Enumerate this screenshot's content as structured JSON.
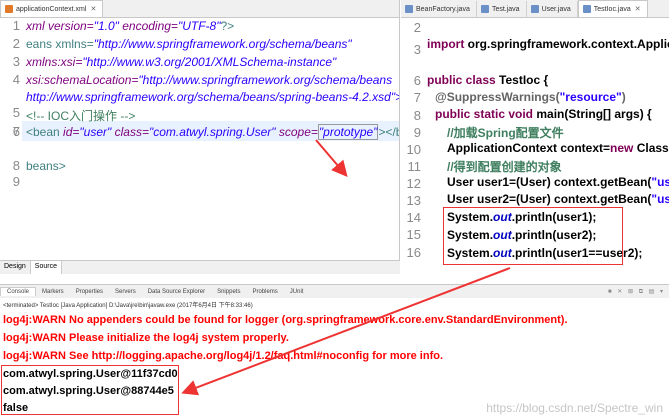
{
  "left_editor": {
    "tab_label": "applicationContext.xml",
    "lines": [
      {
        "num": "1"
      },
      {
        "num": "2"
      },
      {
        "num": "3"
      },
      {
        "num": "4"
      },
      {
        "num": "5"
      },
      {
        "num": "6"
      },
      {
        "num": "7"
      },
      {
        "num": "8"
      },
      {
        "num": "9"
      }
    ],
    "line1": {
      "a": "xml version=",
      "b": "\"1.0\"",
      "c": " encoding=",
      "d": "\"UTF-8\"",
      "e": "?>"
    },
    "line2": {
      "a": "eans xmlns=",
      "b": "\"http://www.springframework.org/schema/beans\""
    },
    "line3": {
      "a": "xmlns:xsi=",
      "b": "\"http://www.w3.org/2001/XMLSchema-instance\""
    },
    "line4": {
      "a": "xsi:schemaLocation=",
      "b": "\"http://www.springframework.org/schema/beans"
    },
    "line4b": "http://www.springframework.org/schema/beans/spring-beans-4.2.xsd\">",
    "line5": "<!-- IOC入门操作 -->",
    "line7": {
      "a": "<bean",
      "b": " id=",
      "c": "\"user\"",
      "d": " class=",
      "e": "\"com.atwyl.spring.User\"",
      "f": " scope=",
      "g": "\"prototype\"",
      "h": "></bean>"
    },
    "line9": "beans>",
    "bottom_tabs": [
      "Design",
      "Source"
    ]
  },
  "right_editor": {
    "tabs": [
      "BeanFactory.java",
      "Test.java",
      "User.java",
      "TestIoc.java"
    ],
    "active_tab": "TestIoc.java",
    "line_numbers": [
      "2",
      "3",
      "6",
      "7",
      "8",
      "9",
      "10",
      "11",
      "12",
      "13",
      "14",
      "15",
      "16"
    ],
    "import_line": {
      "kw": "import",
      "rest": " org.springframework.context.ApplicationCo"
    },
    "class_line": {
      "kw1": "public",
      "kw2": " class",
      "rest": " TestIoc {"
    },
    "suppress_line": {
      "ann": "@SuppressWarnings(",
      "str": "\"resource\"",
      "end": ")"
    },
    "main_line": {
      "kw": "public static void",
      "rest": " main(String[] args) {"
    },
    "comment1": "//加载Spring配置文件",
    "ctx_line": {
      "a": "ApplicationContext context=",
      "kw": "new",
      "b": " ClassPathXm"
    },
    "comment2": "//得到配置创建的对象",
    "user1_line": {
      "a": "User user1=(User) context.getBean(",
      "str": "\"user\"",
      "b": ");"
    },
    "user2_line": {
      "a": "User user2=(User) context.getBean(",
      "str": "\"user\"",
      "b": ");"
    },
    "print1": {
      "a": "System.",
      "fld": "out",
      "b": ".println(user1);"
    },
    "print2": {
      "a": "System.",
      "fld": "out",
      "b": ".println(user2);"
    },
    "print3": {
      "a": "System.",
      "fld": "out",
      "b": ".println(user1==user2);"
    }
  },
  "console": {
    "tabs": [
      "Console",
      "Markers",
      "Properties",
      "Servers",
      "Data Source Explorer",
      "Snippets",
      "Problems",
      "JUnit"
    ],
    "status": "<terminated> TestIoc [Java Application] D:\\Java\\jre\\bin\\javaw.exe (2017年6月4日 下午8:33:46)",
    "warn1": "log4j:WARN No appenders could be found for logger (org.springframework.core.env.StandardEnvironment).",
    "warn2": "log4j:WARN Please initialize the log4j system properly.",
    "warn3": "log4j:WARN See http://logging.apache.org/log4j/1.2/faq.html#noconfig for more info.",
    "out1": "com.atwyl.spring.User@11f37cd0",
    "out2": "com.atwyl.spring.User@88744e5",
    "out3": "false"
  },
  "watermark": "https://blog.csdn.net/Spectre_win"
}
